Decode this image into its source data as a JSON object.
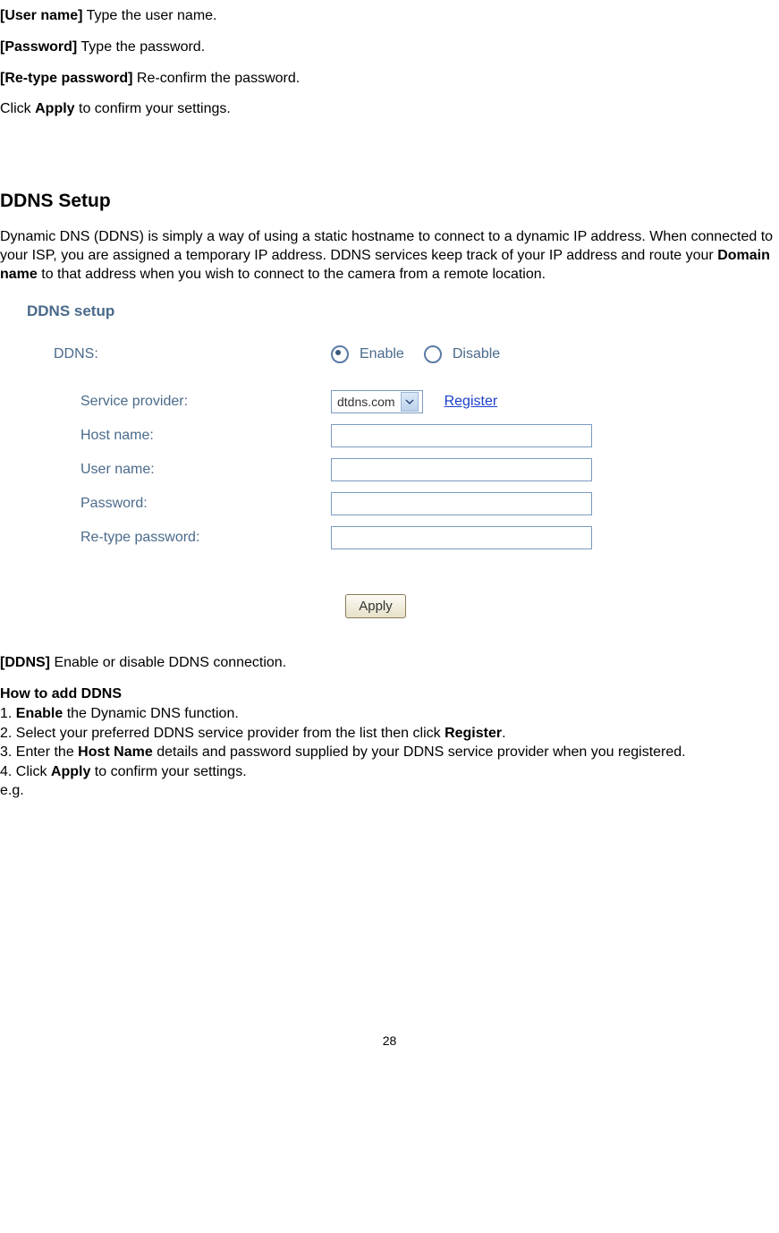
{
  "intro": {
    "username_label": "[User name]",
    "username_text": " Type the user name.",
    "password_label": "[Password]",
    "password_text": " Type the password.",
    "retype_label": "[Re-type password]",
    "retype_text": " Re-confirm the password.",
    "click_text_pre": "Click ",
    "click_bold": "Apply",
    "click_text_post": " to confirm your settings."
  },
  "section_heading": "DDNS Setup",
  "section_para_pre": "Dynamic DNS (DDNS) is simply a way of using a static hostname to connect to a dynamic IP address. When connected to your ISP, you are assigned a temporary IP address. DDNS services keep track of your IP address and route your ",
  "section_para_bold": "Domain name",
  "section_para_post": " to that address when you wish to connect to the camera from a remote location.",
  "figure": {
    "title": "DDNS setup",
    "ddns_label": "DDNS:",
    "enable_label": "Enable",
    "disable_label": "Disable",
    "service_provider_label": "Service provider:",
    "service_provider_value": "dtdns.com",
    "register_link": "Register",
    "hostname_label": "Host name:",
    "username_label": "User name:",
    "password_label": "Password:",
    "retype_label": "Re-type password:",
    "apply_button": "Apply"
  },
  "ddns_field": {
    "label": "[DDNS]",
    "text": " Enable or disable DDNS connection."
  },
  "howto": {
    "heading": "How to add DDNS",
    "step1_pre": "1. ",
    "step1_bold": "Enable",
    "step1_post": " the Dynamic DNS function.",
    "step2_pre": "2. Select your preferred DDNS service provider from the list then click ",
    "step2_bold": "Register",
    "step2_post": ".",
    "step3_pre": "3. Enter the ",
    "step3_bold": "Host Name",
    "step3_post": " details and password supplied by your DDNS service provider when you registered.",
    "step4_pre": "4. Click ",
    "step4_bold": "Apply",
    "step4_post": " to confirm your settings.",
    "eg": "e.g."
  },
  "page_number": "28"
}
